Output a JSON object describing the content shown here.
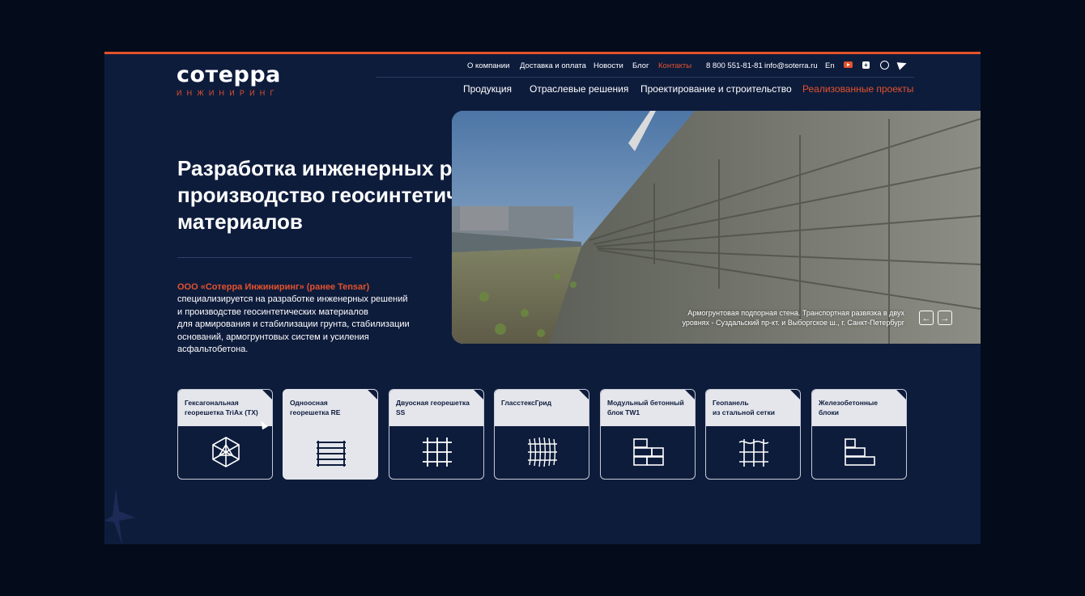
{
  "brand": {
    "logo": "сотерра",
    "tagline": "ИНЖИНИРИНГ"
  },
  "topnav": {
    "items": [
      {
        "label": "О компании"
      },
      {
        "label": "Доставка и оплата"
      },
      {
        "label": "Новости"
      },
      {
        "label": "Блог"
      },
      {
        "label": "Контакты",
        "active": true
      }
    ],
    "phone": "8 800 551-81-81",
    "email": "info@soterra.ru",
    "language": "En",
    "social_icons": [
      "youtube-icon",
      "plus-square-icon",
      "whatsapp-icon",
      "telegram-icon"
    ]
  },
  "mainnav": {
    "items": [
      {
        "label": "Продукция"
      },
      {
        "label": "Отраслевые решения"
      },
      {
        "label": "Проектирование и строительство"
      },
      {
        "label": "Реализованные проекты",
        "active": true
      }
    ]
  },
  "hero": {
    "headline": "Разработка инженерных решений и производство геосинтетических материалов",
    "intro_accent": "ООО «Сотерра Инжиниринг» (ранее Tensar)",
    "intro_text": "специализируется  на разработке инженерных решений\nи производстве геосинтетических материалов\nдля армирования и стабилизации грунта, стабилизации\nоснований, армогрунтовых систем и усиления\nасфальтобетона.",
    "caption": "Армогрунтовая подпорная стена. Транспортная развязка в двух\nуровнях - Суздальский пр-кт. и Выборгское ш., г. Санкт-Петербург",
    "prev_arrow": "←",
    "next_arrow": "→"
  },
  "products": [
    {
      "title": "Гексагональная\nгеорешетка TriAx (TX)",
      "icon": "triax-hexagon-icon"
    },
    {
      "title": "Одноосная\nгеорешетка RE",
      "icon": "uniaxial-grid-icon",
      "highlighted": true
    },
    {
      "title": "Двуосная георешетка\nSS",
      "icon": "biaxial-grid-icon"
    },
    {
      "title": "ГласстексГрид",
      "icon": "glasstex-grid-icon"
    },
    {
      "title": "Модульный бетонный\nблок TW1",
      "icon": "concrete-block-icon"
    },
    {
      "title": "Геопанель\nиз стальной сетки",
      "icon": "steel-mesh-panel-icon"
    },
    {
      "title": "Железобетонные\nблоки",
      "icon": "reinforced-blocks-icon"
    }
  ],
  "colors": {
    "accent": "#e4522c",
    "background": "#0e1c3c",
    "card_head": "#e4e6ec"
  }
}
